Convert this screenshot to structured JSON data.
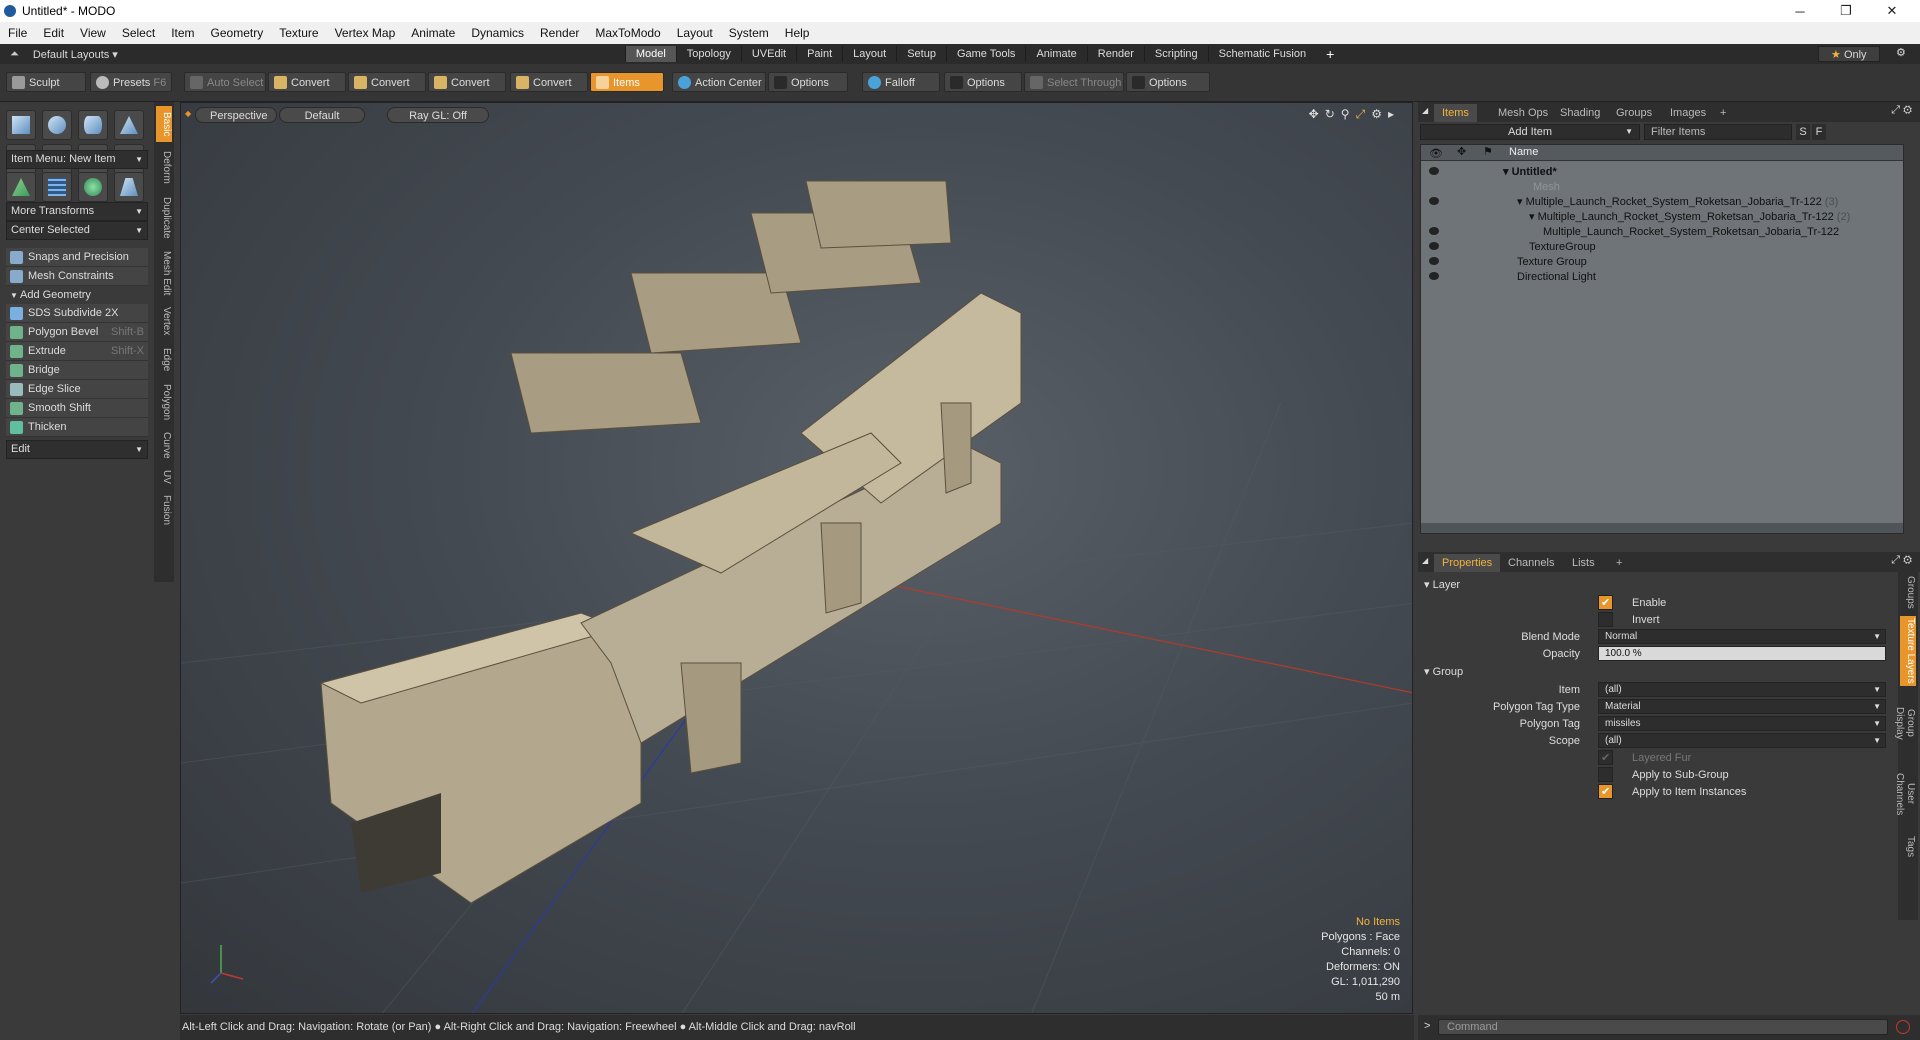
{
  "window": {
    "title": "Untitled* - MODO",
    "controls": [
      "─",
      "❐",
      "✕"
    ]
  },
  "menu": [
    "File",
    "Edit",
    "View",
    "Select",
    "Item",
    "Geometry",
    "Texture",
    "Vertex Map",
    "Animate",
    "Dynamics",
    "Render",
    "MaxToModo",
    "Layout",
    "System",
    "Help"
  ],
  "layout": {
    "selector": "Default Layouts",
    "tabs": [
      "Model",
      "Topology",
      "UVEdit",
      "Paint",
      "Layout",
      "Setup",
      "Game Tools",
      "Animate",
      "Render",
      "Scripting",
      "Schematic Fusion"
    ],
    "active_tab": "Model",
    "add": "+",
    "only": "Only"
  },
  "toolbar": {
    "sculpt": "Sculpt",
    "presets": "Presets",
    "presets_key": "F6",
    "auto_select": "Auto Select",
    "convert1": "Convert",
    "convert2": "Convert",
    "convert3": "Convert",
    "convert4": "Convert",
    "items": "Items",
    "action_center": "Action Center",
    "options1": "Options",
    "falloff": "Falloff",
    "options2": "Options",
    "select_through": "Select Through",
    "options3": "Options"
  },
  "left": {
    "item_menu": "Item Menu: New Item",
    "more_transforms": "More Transforms",
    "center_selected": "Center Selected",
    "snaps": "Snaps and Precision",
    "mesh_constraints": "Mesh Constraints",
    "add_geometry": "Add Geometry",
    "tools": [
      {
        "label": "SDS Subdivide 2X",
        "shortcut": ""
      },
      {
        "label": "Polygon Bevel",
        "shortcut": "Shift-B"
      },
      {
        "label": "Extrude",
        "shortcut": "Shift-X"
      },
      {
        "label": "Bridge",
        "shortcut": ""
      },
      {
        "label": "Edge Slice",
        "shortcut": ""
      },
      {
        "label": "Smooth Shift",
        "shortcut": ""
      },
      {
        "label": "Thicken",
        "shortcut": ""
      }
    ],
    "edit": "Edit",
    "vtabs": [
      "Basic",
      "Deform",
      "Duplicate",
      "Mesh Edit",
      "Vertex",
      "Edge",
      "Polygon",
      "Curve",
      "UV",
      "Fusion"
    ]
  },
  "viewport": {
    "perspective": "Perspective",
    "default": "Default",
    "raygl": "Ray GL: Off",
    "stats": {
      "items": "No Items",
      "polygons": "Polygons : Face",
      "channels": "Channels: 0",
      "deformers": "Deformers: ON",
      "gl": "GL: 1,011,290",
      "scale": "50 m"
    }
  },
  "items_panel": {
    "tabs": [
      "Items",
      "Mesh Ops",
      "Shading",
      "Groups",
      "Images",
      "+"
    ],
    "add_item": "Add Item",
    "filter": "Filter Items",
    "s": "S",
    "f": "F",
    "name_header": "Name",
    "rows": [
      {
        "name": "Untitled*",
        "count": ""
      },
      {
        "name": "Mesh",
        "count": ""
      },
      {
        "name": "Multiple_Launch_Rocket_System_Roketsan_Jobaria_Tr-122",
        "count": "(3)"
      },
      {
        "name": "Multiple_Launch_Rocket_System_Roketsan_Jobaria_Tr-122",
        "count": "(2)"
      },
      {
        "name": "Multiple_Launch_Rocket_System_Roketsan_Jobaria_Tr-122",
        "count": ""
      },
      {
        "name": "TextureGroup",
        "count": ""
      },
      {
        "name": "Texture Group",
        "count": ""
      },
      {
        "name": "Directional Light",
        "count": ""
      }
    ]
  },
  "properties": {
    "tabs": [
      "Properties",
      "Channels",
      "Lists",
      "+"
    ],
    "layer_section": "Layer",
    "enable": "Enable",
    "invert": "Invert",
    "blend_mode_label": "Blend Mode",
    "blend_mode": "Normal",
    "opacity_label": "Opacity",
    "opacity": "100.0 %",
    "group_section": "Group",
    "item_label": "Item",
    "item": "(all)",
    "ptag_type_label": "Polygon Tag Type",
    "ptag_type": "Material",
    "ptag_label": "Polygon Tag",
    "ptag": "missiles",
    "scope_label": "Scope",
    "scope": "(all)",
    "layered_fur": "Layered Fur",
    "apply_sub": "Apply to Sub-Group",
    "apply_inst": "Apply to Item Instances",
    "vtabs": [
      "Groups",
      "Texture Layers",
      "Group Display",
      "User Channels",
      "Tags"
    ]
  },
  "status": {
    "hint": "Alt-Left Click and Drag: Navigation: Rotate (or Pan) ● Alt-Right Click and Drag: Navigation: Freewheel ● Alt-Middle Click and Drag: navRoll",
    "command": "Command"
  },
  "colors": {
    "accent": "#e8952b",
    "selected_text": "#f0b43c"
  }
}
